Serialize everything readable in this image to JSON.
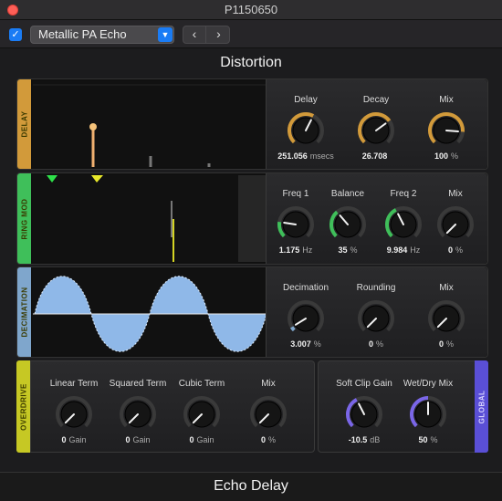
{
  "window": {
    "title": "P1150650"
  },
  "toolbar": {
    "preset": "Metallic PA Echo",
    "enabled": true,
    "prev": "‹",
    "next": "›"
  },
  "plugin_title": "Distortion",
  "footer_title": "Echo Delay",
  "colors": {
    "delay": "#d29a3a",
    "ringmod": "#3fbf5a",
    "decimation": "#7fa6cc",
    "overdrive": "#c6c824",
    "global": "#5a4fd6",
    "accent": "#1a7cf5"
  },
  "sections": {
    "delay": {
      "tag": "DELAY",
      "knobs": [
        {
          "label": "Delay",
          "value": "251.056",
          "unit": "msecs",
          "level": 0.6
        },
        {
          "label": "Decay",
          "value": "26.708",
          "unit": "",
          "level": 0.7
        },
        {
          "label": "Mix",
          "value": "100",
          "unit": "%",
          "level": 0.85
        }
      ]
    },
    "ringmod": {
      "tag": "RING MOD",
      "knobs": [
        {
          "label": "Freq 1",
          "value": "1.175",
          "unit": "Hz",
          "level": 0.2
        },
        {
          "label": "Balance",
          "value": "35",
          "unit": "%",
          "level": 0.35
        },
        {
          "label": "Freq 2",
          "value": "9.984",
          "unit": "Hz",
          "level": 0.4
        },
        {
          "label": "Mix",
          "value": "0",
          "unit": "%",
          "level": 0.0
        }
      ]
    },
    "decimation": {
      "tag": "DECIMATION",
      "knobs": [
        {
          "label": "Decimation",
          "value": "3.007",
          "unit": "%",
          "level": 0.05
        },
        {
          "label": "Rounding",
          "value": "0",
          "unit": "%",
          "level": 0.0
        },
        {
          "label": "Mix",
          "value": "0",
          "unit": "%",
          "level": 0.0
        }
      ]
    },
    "overdrive": {
      "tag": "OVERDRIVE",
      "knobs": [
        {
          "label": "Linear Term",
          "value": "0",
          "unit": "Gain",
          "level": 0.0
        },
        {
          "label": "Squared Term",
          "value": "0",
          "unit": "Gain",
          "level": 0.0
        },
        {
          "label": "Cubic Term",
          "value": "0",
          "unit": "Gain",
          "level": 0.0
        },
        {
          "label": "Mix",
          "value": "0",
          "unit": "%",
          "level": 0.0
        }
      ]
    },
    "global": {
      "tag": "GLOBAL",
      "knobs": [
        {
          "label": "Soft Clip Gain",
          "value": "-10.5",
          "unit": "dB",
          "level": 0.4
        },
        {
          "label": "Wet/Dry Mix",
          "value": "50",
          "unit": "%",
          "level": 0.5
        }
      ]
    }
  }
}
